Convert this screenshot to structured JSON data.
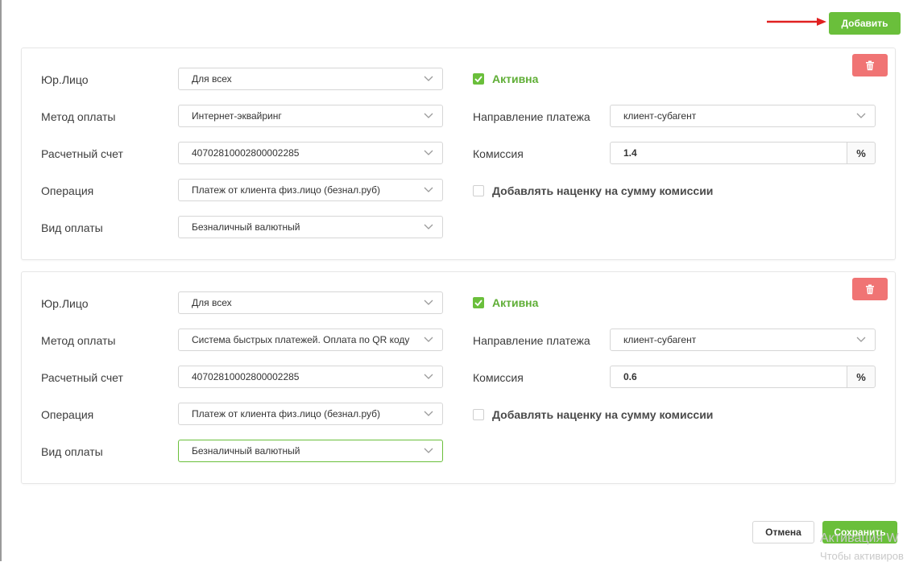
{
  "header": {
    "add_label": "Добавить"
  },
  "labels": {
    "legal_entity": "Юр.Лицо",
    "payment_method": "Метод оплаты",
    "account": "Расчетный счет",
    "operation": "Операция",
    "payment_type": "Вид оплаты",
    "active": "Активна",
    "direction": "Направление платежа",
    "commission": "Комиссия",
    "add_markup": "Добавлять наценку на сумму комиссии",
    "percent": "%"
  },
  "cards": [
    {
      "legal_entity": "Для всех",
      "payment_method": "Интернет-эквайринг",
      "account": "40702810002800002285",
      "operation": "Платеж от клиента физ.лицо (безнал.руб)",
      "payment_type": "Безналичный валютный",
      "active": true,
      "direction": "клиент-субагент",
      "commission": "1.4",
      "add_markup": false
    },
    {
      "legal_entity": "Для всех",
      "payment_method": "Система быстрых платежей. Оплата по QR коду",
      "account": "40702810002800002285",
      "operation": "Платеж от клиента физ.лицо (безнал.руб)",
      "payment_type": "Безналичный валютный",
      "active": true,
      "direction": "клиент-субагент",
      "commission": "0.6",
      "add_markup": false
    }
  ],
  "footer": {
    "cancel_label": "Отмена",
    "save_label": "Сохранить"
  },
  "watermark": {
    "line1": "Активация W",
    "line2": "Чтобы активиров"
  },
  "colors": {
    "accent": "#6abf3b",
    "danger": "#f07474",
    "arrow": "#e02020"
  }
}
